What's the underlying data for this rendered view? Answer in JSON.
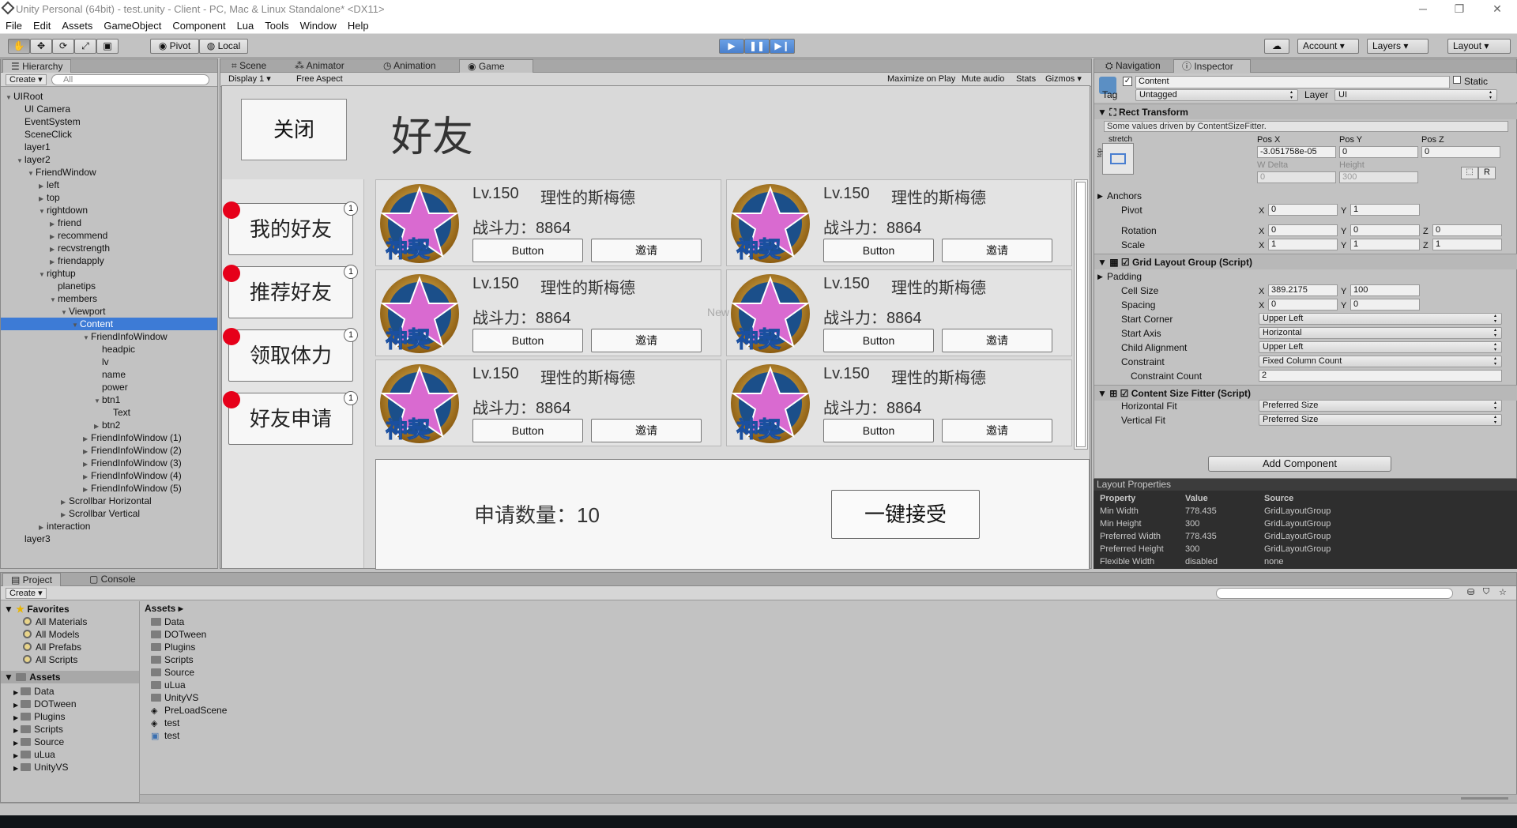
{
  "window": {
    "title": "Unity Personal (64bit) - test.unity - Client - PC, Mac & Linux Standalone* <DX11>"
  },
  "menu": [
    "File",
    "Edit",
    "Assets",
    "GameObject",
    "Component",
    "Lua",
    "Tools",
    "Window",
    "Help"
  ],
  "toolbar": {
    "pivot": "Pivot",
    "local": "Local",
    "account": "Account",
    "layers": "Layers",
    "layout": "Layout"
  },
  "hierarchy": {
    "tab": "Hierarchy",
    "create": "Create",
    "search_placeholder": "All",
    "nodes": [
      "UIRoot",
      "UI Camera",
      "EventSystem",
      "SceneClick",
      "layer1",
      "layer2",
      "FriendWindow",
      "left",
      "top",
      "rightdown",
      "friend",
      "recommend",
      "recvstrength",
      "friendapply",
      "rightup",
      "planetips",
      "members",
      "Viewport",
      "Content",
      "FriendInfoWindow",
      "headpic",
      "lv",
      "name",
      "power",
      "btn1",
      "Text",
      "btn2",
      "FriendInfoWindow (1)",
      "FriendInfoWindow (2)",
      "FriendInfoWindow (3)",
      "FriendInfoWindow (4)",
      "FriendInfoWindow (5)",
      "Scrollbar Horizontal",
      "Scrollbar Vertical",
      "interaction",
      "layer3"
    ]
  },
  "center_tabs": [
    "Scene",
    "Animator",
    "Animation",
    "Game"
  ],
  "game_bar": {
    "display": "Display 1",
    "aspect": "Free Aspect",
    "maximize": "Maximize on Play",
    "mute": "Mute audio",
    "stats": "Stats",
    "gizmos": "Gizmos"
  },
  "game": {
    "close": "关闭",
    "title": "好友",
    "side": [
      {
        "label": "我的好友",
        "badge": "1"
      },
      {
        "label": "推荐好友",
        "badge": "1"
      },
      {
        "label": "领取体力",
        "badge": "1"
      },
      {
        "label": "好友申请",
        "badge": "1"
      }
    ],
    "cards": [
      {
        "lv": "Lv.150",
        "name": "理性的斯梅德",
        "power": "战斗力：8864",
        "btn1": "Button",
        "btn2": "邀请",
        "emblem": "神契"
      },
      {
        "lv": "Lv.150",
        "name": "理性的斯梅德",
        "power": "战斗力：8864",
        "btn1": "Button",
        "btn2": "邀请",
        "emblem": "神契"
      },
      {
        "lv": "Lv.150",
        "name": "理性的斯梅德",
        "power": "战斗力：8864",
        "btn1": "Button",
        "btn2": "邀请",
        "emblem": "神契"
      },
      {
        "lv": "Lv.150",
        "name": "理性的斯梅德",
        "power": "战斗力：8864",
        "btn1": "Button",
        "btn2": "邀请",
        "emblem": "神契"
      },
      {
        "lv": "Lv.150",
        "name": "理性的斯梅德",
        "power": "战斗力：8864",
        "btn1": "Button",
        "btn2": "邀请",
        "emblem": "神契"
      },
      {
        "lv": "Lv.150",
        "name": "理性的斯梅德",
        "power": "战斗力：8864",
        "btn1": "Button",
        "btn2": "邀请",
        "emblem": "神契"
      }
    ],
    "ghost": "New",
    "apply_count": "申请数量：10",
    "accept_all": "一键接受"
  },
  "inspector": {
    "tabs": [
      "Navigation",
      "Inspector"
    ],
    "name": "Content",
    "static": "Static",
    "tag_label": "Tag",
    "tag": "Untagged",
    "layer_label": "Layer",
    "layer": "UI",
    "rect": {
      "title": "Rect Transform",
      "note": "Some values driven by ContentSizeFitter.",
      "stretch": "stretch",
      "top": "top",
      "posx_label": "Pos X",
      "posy_label": "Pos Y",
      "posz_label": "Pos Z",
      "posx": "-3.051758e-05",
      "posy": "0",
      "posz": "0",
      "wdelta_label": "W Delta",
      "height_label": "Height",
      "wdelta": "0",
      "height": "300",
      "r": "R",
      "anchors": "Anchors",
      "pivot": "Pivot",
      "pivot_x": "0",
      "pivot_y": "1",
      "rotation": "Rotation",
      "rot_x": "0",
      "rot_y": "0",
      "rot_z": "0",
      "scale": "Scale",
      "scale_x": "1",
      "scale_y": "1",
      "scale_z": "1"
    },
    "grid": {
      "title": "Grid Layout Group (Script)",
      "padding": "Padding",
      "cell_size": "Cell Size",
      "cell_x": "389.2175",
      "cell_y": "100",
      "spacing": "Spacing",
      "sp_x": "0",
      "sp_y": "0",
      "start_corner": "Start Corner",
      "start_corner_v": "Upper Left",
      "start_axis": "Start Axis",
      "start_axis_v": "Horizontal",
      "child_align": "Child Alignment",
      "child_align_v": "Upper Left",
      "constraint": "Constraint",
      "constraint_v": "Fixed Column Count",
      "constraint_count": "Constraint Count",
      "constraint_count_v": "2"
    },
    "fitter": {
      "title": "Content Size Fitter (Script)",
      "hfit": "Horizontal Fit",
      "hfit_v": "Preferred Size",
      "vfit": "Vertical Fit",
      "vfit_v": "Preferred Size"
    },
    "add_component": "Add Component"
  },
  "layout_props": {
    "title": "Layout Properties",
    "headers": [
      "Property",
      "Value",
      "Source"
    ],
    "rows": [
      [
        "Min Width",
        "778.435",
        "GridLayoutGroup"
      ],
      [
        "Min Height",
        "300",
        "GridLayoutGroup"
      ],
      [
        "Preferred Width",
        "778.435",
        "GridLayoutGroup"
      ],
      [
        "Preferred Height",
        "300",
        "GridLayoutGroup"
      ],
      [
        "Flexible Width",
        "disabled",
        "none"
      ]
    ]
  },
  "project": {
    "tabs": [
      "Project",
      "Console"
    ],
    "create": "Create",
    "favorites": "Favorites",
    "fav_items": [
      "All Materials",
      "All Models",
      "All Prefabs",
      "All Scripts"
    ],
    "assets_label": "Assets",
    "tree": [
      "Data",
      "DOTween",
      "Plugins",
      "Scripts",
      "Source",
      "uLua",
      "UnityVS"
    ],
    "breadcrumb": "Assets",
    "files": [
      "Data",
      "DOTween",
      "Plugins",
      "Scripts",
      "Source",
      "uLua",
      "UnityVS",
      "PreLoadScene",
      "test",
      "test"
    ]
  }
}
